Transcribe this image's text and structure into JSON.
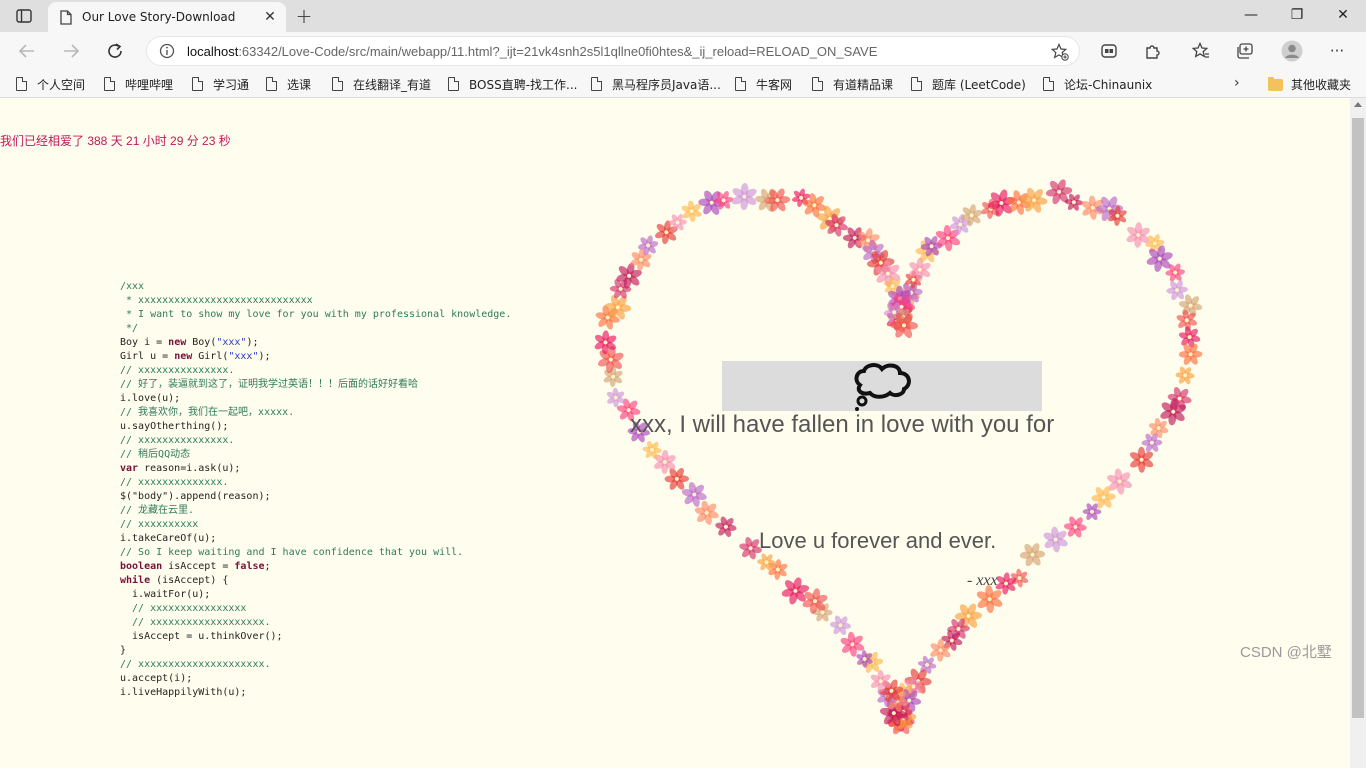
{
  "browser": {
    "tab_title": "Our Love Story-Download",
    "close_glyph": "✕",
    "newtab_glyph": "+",
    "address": {
      "host": "localhost",
      "rest": ":63342/Love-Code/src/main/webapp/11.html?_ijt=21vk4snh2s5l1qllne0fi0htes&_ij_reload=RELOAD_ON_SAVE"
    },
    "window": {
      "minimize": "—",
      "restore": "❐",
      "close": "✕"
    },
    "more_glyph": "···"
  },
  "favorites": {
    "items": [
      "个人空间",
      "哔哩哔哩",
      "学习通",
      "选课",
      "在线翻译_有道",
      "BOSS直聘-找工作...",
      "黑马程序员Java语...",
      "牛客网",
      "有道精品课",
      "题库 (LeetCode)",
      "论坛-Chinaunix"
    ],
    "more_glyph": "›",
    "other": "其他收藏夹"
  },
  "page": {
    "counter": "我们已经相爱了 388 天 21 小时 29 分 23 秒",
    "code_lines": [
      [
        [
          "c",
          "/xxx"
        ]
      ],
      [
        [
          "c",
          " * xxxxxxxxxxxxxxxxxxxxxxxxxxxxx"
        ]
      ],
      [
        [
          "c",
          " * I want to show my love for you with my professional knowledge."
        ]
      ],
      [
        [
          "c",
          " */"
        ]
      ],
      [
        [
          "t",
          "Boy i = "
        ],
        [
          "k",
          "new"
        ],
        [
          "t",
          " Boy("
        ],
        [
          "s",
          "\"xxx\""
        ],
        [
          "t",
          ");"
        ]
      ],
      [
        [
          "t",
          "Girl u = "
        ],
        [
          "k",
          "new"
        ],
        [
          "t",
          " Girl("
        ],
        [
          "s",
          "\"xxx\""
        ],
        [
          "t",
          ");"
        ]
      ],
      [
        [
          "c",
          "// xxxxxxxxxxxxxxx."
        ]
      ],
      [
        [
          "c",
          "// 好了，装逼就到这了，证明我学过英语！！！后面的话好好看哈"
        ]
      ],
      [
        [
          "t",
          "i.love(u);"
        ]
      ],
      [
        [
          "c",
          "// 我喜欢你，我们在一起吧，xxxxx."
        ]
      ],
      [
        [
          "t",
          "u.sayOtherthing();"
        ]
      ],
      [
        [
          "c",
          "// xxxxxxxxxxxxxxx."
        ]
      ],
      [
        [
          "c",
          "// 稍后QQ动态"
        ]
      ],
      [
        [
          "k",
          "var"
        ],
        [
          "t",
          " reason=i.ask(u);"
        ]
      ],
      [
        [
          "c",
          "// xxxxxxxxxxxxxx."
        ]
      ],
      [
        [
          "t",
          "$(\"body\").append(reason);"
        ]
      ],
      [
        [
          "c",
          "// 龙藏在云里."
        ]
      ],
      [
        [
          "c",
          "// xxxxxxxxxx"
        ]
      ],
      [
        [
          "t",
          "i.takeCareOf(u);"
        ]
      ],
      [
        [
          "c",
          "// So I keep waiting and I have confidence that you will."
        ]
      ],
      [
        [
          "k",
          "boolean"
        ],
        [
          "t",
          " isAccept = "
        ],
        [
          "k",
          "false"
        ],
        [
          "t",
          ";"
        ]
      ],
      [
        [
          "k",
          "while"
        ],
        [
          "t",
          " (isAccept) {"
        ]
      ],
      [
        [
          "t",
          "  i.waitFor(u);"
        ]
      ],
      [
        [
          "c",
          "  // xxxxxxxxxxxxxxxx"
        ]
      ],
      [
        [
          "c",
          "  // xxxxxxxxxxxxxxxxxxx."
        ]
      ],
      [
        [
          "t",
          "  isAccept = u.thinkOver();"
        ]
      ],
      [
        [
          "t",
          "}"
        ]
      ],
      [
        [
          "c",
          "// xxxxxxxxxxxxxxxxxxxxx."
        ]
      ],
      [
        [
          "t",
          "u.accept(i);"
        ]
      ],
      [
        [
          "t",
          "i.liveHappilyWith(u);"
        ]
      ]
    ],
    "love_line": "xxx, I will have fallen in love with you for",
    "forever": "Love u forever and ever.",
    "signature": "- xxx",
    "watermark": "CSDN @北墅",
    "heart": {
      "flower_count": 120,
      "palette": [
        "#e8175d",
        "#ff6f3c",
        "#f9a03f",
        "#d6336c",
        "#c2185b",
        "#ff8a65",
        "#ba68c8",
        "#e53935",
        "#f48fb1",
        "#ffb74d",
        "#ab47bc",
        "#ff4081",
        "#ce93d8",
        "#d4a373",
        "#ef5350"
      ]
    }
  }
}
